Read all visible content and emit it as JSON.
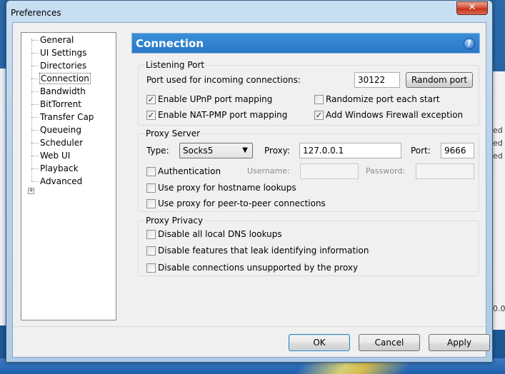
{
  "window": {
    "title": "Preferences",
    "close_glyph": "✕"
  },
  "background_right": [
    "ed",
    "ed",
    "ed",
    "0.0"
  ],
  "tree": {
    "items": [
      "General",
      "UI Settings",
      "Directories",
      "Connection",
      "Bandwidth",
      "BitTorrent",
      "Transfer Cap",
      "Queueing",
      "Scheduler",
      "Web UI",
      "Playback",
      "Advanced"
    ],
    "selected": "Connection",
    "expander_glyph": "+"
  },
  "header": {
    "title": "Connection",
    "help_glyph": "?"
  },
  "listening_port": {
    "title": "Listening Port",
    "port_label": "Port used for incoming connections:",
    "port_value": "30122",
    "random_port_button": "Random port",
    "upnp": {
      "label": "Enable UPnP port mapping",
      "checked": true
    },
    "randomize": {
      "label": "Randomize port each start",
      "checked": false
    },
    "nat_pmp": {
      "label": "Enable NAT-PMP port mapping",
      "checked": true
    },
    "firewall": {
      "label": "Add Windows Firewall exception",
      "checked": true
    }
  },
  "proxy_server": {
    "title": "Proxy Server",
    "type_label": "Type:",
    "type_value": "Socks5",
    "proxy_label": "Proxy:",
    "proxy_value": "127.0.0.1",
    "port_label": "Port:",
    "port_value": "9666",
    "authentication": {
      "label": "Authentication",
      "checked": false
    },
    "username_label": "Username:",
    "password_label": "Password:",
    "hostname_lookups": {
      "label": "Use proxy for hostname lookups",
      "checked": false
    },
    "p2p": {
      "label": "Use proxy for peer-to-peer connections",
      "checked": false
    }
  },
  "proxy_privacy": {
    "title": "Proxy Privacy",
    "dns": {
      "label": "Disable all local DNS lookups",
      "checked": false
    },
    "leak": {
      "label": "Disable features that leak identifying information",
      "checked": false
    },
    "unsupported": {
      "label": "Disable connections unsupported by the proxy",
      "checked": false
    }
  },
  "footer": {
    "ok": "OK",
    "cancel": "Cancel",
    "apply": "Apply"
  },
  "colors": {
    "header_blue": "#2a78c8",
    "title_bar": "#b8d3ec",
    "close_red": "#c1331a"
  }
}
